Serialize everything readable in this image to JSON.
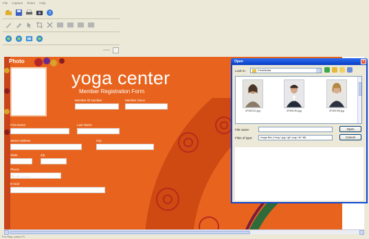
{
  "menu": [
    "File",
    "Capture",
    "Share",
    "Help"
  ],
  "toolbar": {
    "row1": [
      "open-icon",
      "save-icon",
      "print-icon",
      "camera-icon",
      "help-icon"
    ],
    "row2": [
      "pen-icon",
      "brush-icon",
      "select-icon",
      "crop-icon",
      "delete-icon",
      "align-left-icon",
      "align-center-icon",
      "align-right-icon",
      "align-justify-icon"
    ],
    "row3": [
      "zoom-in-icon",
      "zoom-out-icon",
      "fit-icon",
      "refresh-icon"
    ]
  },
  "form": {
    "photo_label": "Photo",
    "title": "yoga center",
    "subtitle": "Member Registration Form",
    "fields": {
      "member_id_label": "Member ID Number",
      "member_since_label": "Member Since",
      "first_name_label": "First Name",
      "last_name_label": "Last Name",
      "street_label": "Street Address",
      "city_label": "City",
      "state_label": "State",
      "zip_label": "Zip",
      "phone_label": "Phone",
      "phone_value": "(___) ___-____",
      "email_label": "E-mail"
    }
  },
  "dialog": {
    "title": "Open",
    "close": "×",
    "look_in_label": "Look in:",
    "look_in_value": "FreeMedia",
    "files": [
      {
        "caption": "0P4RCD1.jpg"
      },
      {
        "caption": "0P4RCR4.jpg"
      },
      {
        "caption": "0P4RCR5.jpg"
      }
    ],
    "file_name_label": "File name:",
    "file_name_value": "",
    "files_of_type_label": "Files of type:",
    "files_of_type_value": "Image files (*.bmp;*.jpg;*.gif;*.png;*.tif;*.tiff)",
    "open_button": "Open",
    "cancel_button": "Cancel"
  },
  "status": {
    "text": "For Help, press F1"
  },
  "colors": {
    "canvas": "#e8641e",
    "dialog_title": "#0a46d4",
    "field": "#ffffff"
  }
}
